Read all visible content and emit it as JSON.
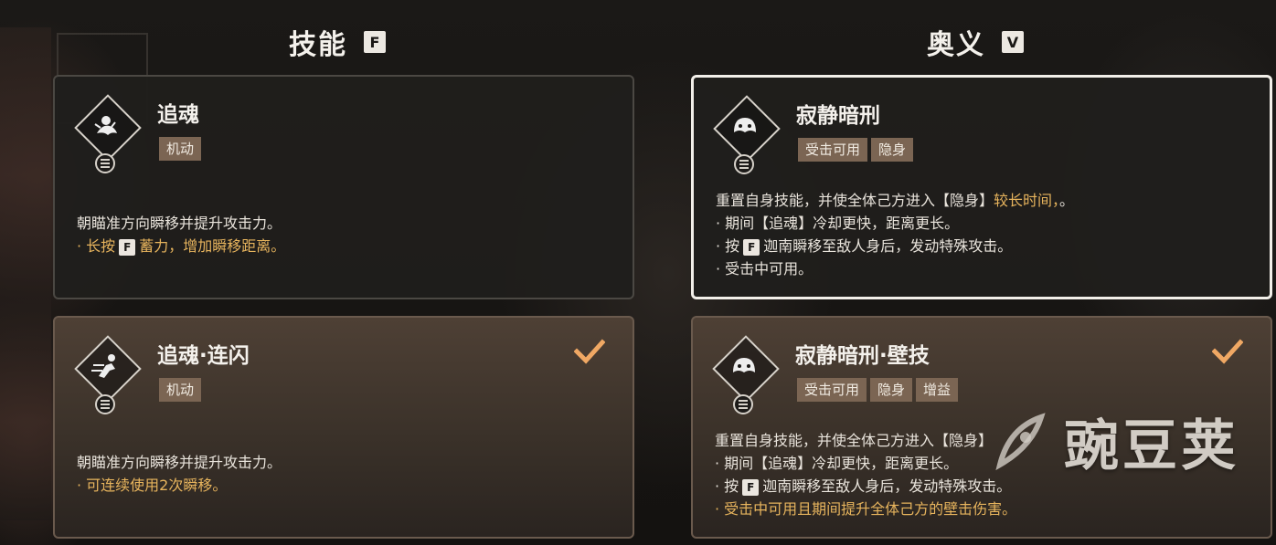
{
  "columns": {
    "skill": {
      "title": "技能",
      "key": "F"
    },
    "ultimate": {
      "title": "奥义",
      "key": "V"
    }
  },
  "cards": {
    "c1": {
      "title": "追魂",
      "icon": "chasing-soul-icon",
      "tags": [
        "机动"
      ],
      "lines": [
        "朝瞄准方向瞬移并提升攻击力。"
      ],
      "gold_prefix": "· 长按",
      "gold_key": "F",
      "gold_suffix": "蓄力，增加瞬移距离。"
    },
    "c2": {
      "title": "追魂·连闪",
      "icon": "dash-figure-icon",
      "tags": [
        "机动"
      ],
      "lines": [
        "朝瞄准方向瞬移并提升攻击力。"
      ],
      "gold_line": "· 可连续使用2次瞬移。"
    },
    "c3": {
      "title": "寂静暗刑",
      "icon": "masked-face-icon",
      "tags": [
        "受击可用",
        "隐身"
      ],
      "desc_main": "重置自身技能，并使全体己方进入【隐身】",
      "desc_gold": "较长时间，",
      "desc_tail": "。",
      "l2": "· 期间【追魂】冷却更快，距离更长。",
      "l3_prefix": "· 按",
      "l3_key": "F",
      "l3_suffix": "迦南瞬移至敌人身后，发动特殊攻击。",
      "l4": "· 受击中可用。"
    },
    "c4": {
      "title": "寂静暗刑·壁技",
      "icon": "masked-face-icon",
      "tags": [
        "受击可用",
        "隐身",
        "增益"
      ],
      "l1": "重置自身技能，并使全体己方进入【隐身】",
      "l2": "· 期间【追魂】冷却更快，距离更长。",
      "l3_prefix": "· 按",
      "l3_key": "F",
      "l3_suffix": "迦南瞬移至敌人身后，发动特殊攻击。",
      "gold_line": "· 受击中可用且期间提升全体己方的壁击伤害。"
    }
  },
  "watermark": "豌豆荚",
  "colors": {
    "gold": "#e7b45d",
    "tag_bg": "#7b6553",
    "check": "#f0a864"
  }
}
